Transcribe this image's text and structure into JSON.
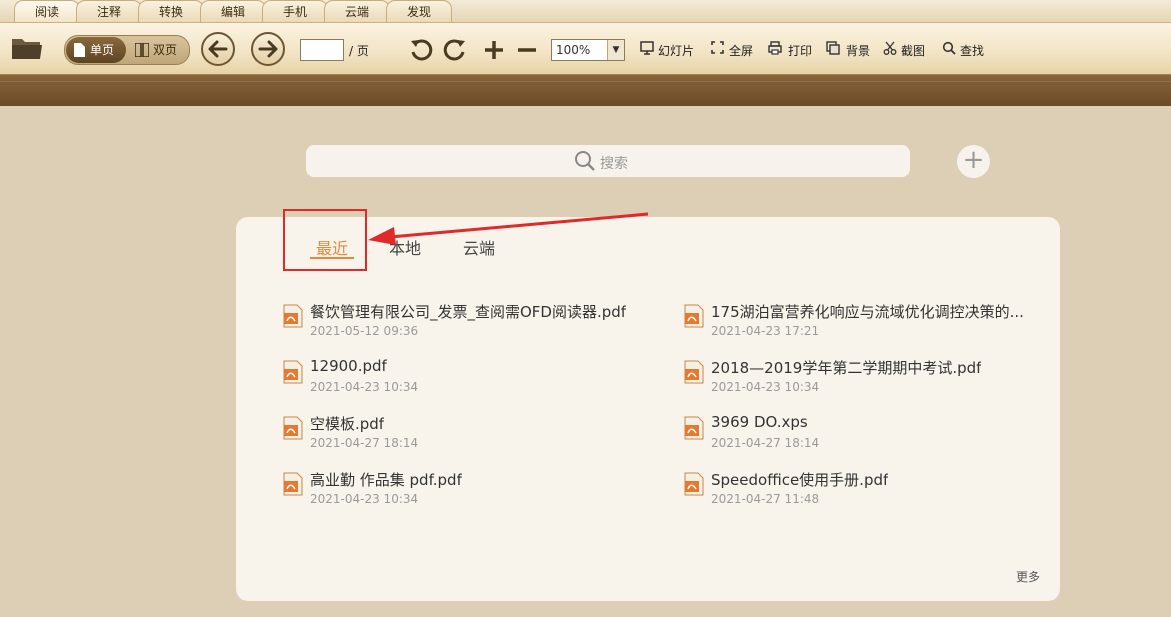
{
  "tabs": [
    "阅读",
    "注释",
    "转换",
    "编辑",
    "手机",
    "云端",
    "发现"
  ],
  "toolbar": {
    "single_page": "单页",
    "double_page": "双页",
    "page_suffix": "/ 页",
    "page_value": "",
    "zoom": "100%",
    "slideshow": "幻灯片",
    "fullscreen": "全屏",
    "print": "打印",
    "background": "背景",
    "screenshot": "截图",
    "find": "查找"
  },
  "search": {
    "placeholder": "搜索"
  },
  "library_tabs": {
    "recent": "最近",
    "local": "本地",
    "cloud": "云端"
  },
  "files": [
    {
      "name": "餐饮管理有限公司_发票_查阅需OFD阅读器.pdf",
      "date": "2021-05-12 09:36"
    },
    {
      "name": "175湖泊富营养化响应与流域优化调控决策的...",
      "date": "2021-04-23 17:21"
    },
    {
      "name": "12900.pdf",
      "date": "2021-04-23 10:34"
    },
    {
      "name": "2018—2019学年第二学期期中考试.pdf",
      "date": "2021-04-23 10:34"
    },
    {
      "name": "空模板.pdf",
      "date": "2021-04-27 18:14"
    },
    {
      "name": "3969 DO.xps",
      "date": "2021-04-27 18:14"
    },
    {
      "name": "高业勤 作品集 pdf.pdf",
      "date": "2021-04-23 10:34"
    },
    {
      "name": "Speedoffice使用手册.pdf",
      "date": "2021-04-27 11:48"
    }
  ],
  "more": "更多",
  "colors": {
    "accent": "#e8873b",
    "highlight": "#e02a2a",
    "band": "#6b4c27"
  },
  "icons": [
    "folder-icon",
    "undo-icon",
    "redo-icon",
    "zoom-in-icon",
    "zoom-out-icon",
    "slideshow-icon",
    "fullscreen-icon",
    "print-icon",
    "background-icon",
    "screenshot-icon",
    "search-icon",
    "add-icon",
    "pdf-file-icon"
  ]
}
